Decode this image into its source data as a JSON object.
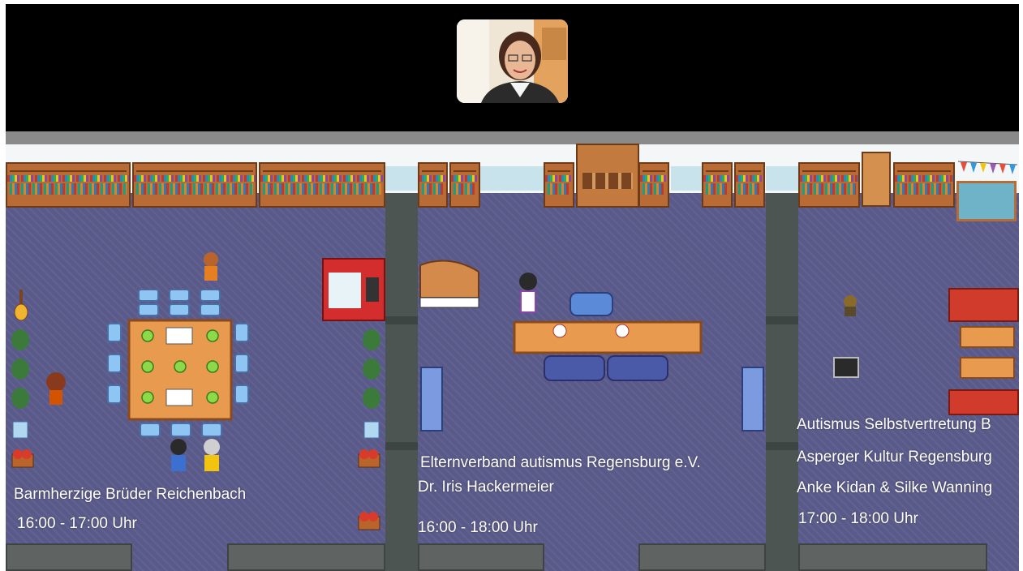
{
  "video": {
    "participant": "video-participant"
  },
  "rooms": [
    {
      "title": "Barmherzige Brüder Reichenbach",
      "time": "16:00 - 17:00 Uhr"
    },
    {
      "title": "Elternverband autismus Regensburg e.V.",
      "subtitle": "Dr. Iris Hackermeier",
      "time": "16:00 - 18:00 Uhr"
    },
    {
      "title": "Autismus Selbstvertretung B",
      "subtitle": "Asperger Kultur Regensburg",
      "presenters": "Anke Kidan & Silke Wanning",
      "time": "17:00 - 18:00 Uhr"
    }
  ],
  "colors": {
    "floor": "#5a5a8a",
    "wall": "#4d5553",
    "shelf": "#b86b34",
    "table": "#e89a4f",
    "chair": "#8ec5f2",
    "vending": "#d32d2d",
    "sofa": "#d13b2b"
  }
}
